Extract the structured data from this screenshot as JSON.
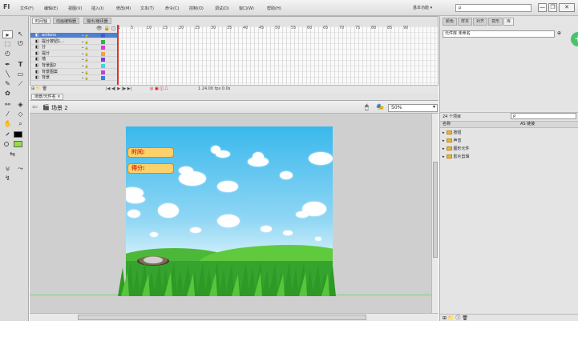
{
  "app": {
    "logo": "Fl"
  },
  "menu": [
    "文件(F)",
    "编辑(E)",
    "视图(V)",
    "插入(I)",
    "修改(M)",
    "文本(T)",
    "命令(C)",
    "控制(O)",
    "调试(D)",
    "窗口(W)",
    "帮助(H)"
  ],
  "workspace": "基本功能 ▾",
  "search": {
    "placeholder": "ρ"
  },
  "window_buttons": [
    "—",
    "❐",
    "✕"
  ],
  "timeline": {
    "tabs": [
      "时间轴",
      "动画编辑器",
      "输出/编译器"
    ],
    "frame_numbers": [
      "1",
      "5",
      "10",
      "15",
      "20",
      "25",
      "30",
      "35",
      "40",
      "45",
      "50",
      "55",
      "60",
      "65",
      "70",
      "75",
      "80",
      "85",
      "90"
    ],
    "layers": [
      {
        "name": "actions",
        "color": "#3b5bd9"
      },
      {
        "name": "提分按钮1...",
        "color": "#2bb34a"
      },
      {
        "name": "分",
        "color": "#d93bd9"
      },
      {
        "name": "提分",
        "color": "#e8a63c"
      },
      {
        "name": "墙",
        "color": "#7a3bd9"
      },
      {
        "name": "背景图2",
        "color": "#3bd9d9"
      },
      {
        "name": "背景图案",
        "color": "#c63bd9"
      },
      {
        "name": "背景",
        "color": "#3b7bd9"
      }
    ],
    "footer": "1 24.00 fps 0.0s"
  },
  "scene": {
    "tab": "场景/元件名 ×",
    "crumb": "场景 2"
  },
  "zoom": "50%",
  "stage": {
    "labels": [
      "时间:",
      "得分:"
    ],
    "colors": {
      "sky_top": "#39b8ec",
      "grass": "#34a42e"
    }
  },
  "right_panel": {
    "tabs": [
      "颜色",
      "样本",
      "对齐",
      "变形",
      "库"
    ],
    "lib_dropdown": "元件库 未命名",
    "items_count": "24 个项目",
    "columns": [
      "名称",
      "AS 链接"
    ],
    "tree": [
      "按钮",
      "声音",
      "图形元件",
      "影片剪辑"
    ]
  }
}
